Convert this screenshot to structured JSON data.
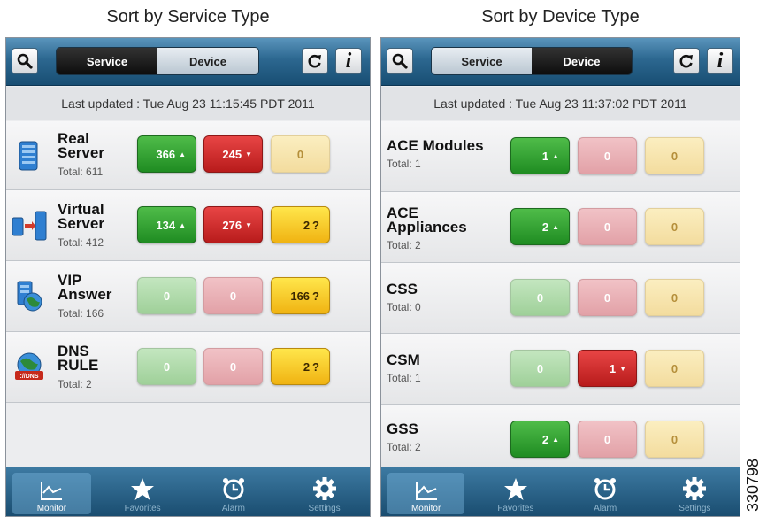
{
  "captions": {
    "left": "Sort by Service Type",
    "right": "Sort by Device Type"
  },
  "left_screen": {
    "segmented": {
      "service": "Service",
      "device": "Device",
      "selected": "Service"
    },
    "last_updated": "Last updated : Tue Aug 23 11:15:45 PDT 2011",
    "rows": [
      {
        "title": [
          "Real",
          "Server"
        ],
        "total": "Total: 611",
        "icon": "real-server-icon",
        "green": "366",
        "red": "245",
        "yellow": "0"
      },
      {
        "title": [
          "Virtual",
          "Server"
        ],
        "total": "Total: 412",
        "icon": "virtual-server-icon",
        "green": "134",
        "red": "276",
        "yellow": "2"
      },
      {
        "title": [
          "VIP",
          "Answer"
        ],
        "total": "Total: 166",
        "icon": "vip-answer-icon",
        "green": "0",
        "red": "0",
        "yellow": "166"
      },
      {
        "title": [
          "DNS",
          "RULE"
        ],
        "total": "Total: 2",
        "icon": "dns-rule-icon",
        "icon_text": "://DNS",
        "green": "0",
        "red": "0",
        "yellow": "2"
      }
    ]
  },
  "right_screen": {
    "segmented": {
      "service": "Service",
      "device": "Device",
      "selected": "Device"
    },
    "last_updated": "Last updated : Tue Aug 23 11:37:02 PDT 2011",
    "rows": [
      {
        "title": [
          "ACE Modules"
        ],
        "total": "Total: 1",
        "green": "1",
        "red": "0",
        "yellow": "0"
      },
      {
        "title": [
          "ACE",
          "Appliances"
        ],
        "total": "Total: 2",
        "green": "2",
        "red": "0",
        "yellow": "0"
      },
      {
        "title": [
          "CSS"
        ],
        "total": "Total: 0",
        "green": "0",
        "red": "0",
        "yellow": "0"
      },
      {
        "title": [
          "CSM"
        ],
        "total": "Total: 1",
        "green": "0",
        "red": "1",
        "yellow": "0"
      },
      {
        "title": [
          "GSS"
        ],
        "total": "Total: 2",
        "green": "2",
        "red": "0",
        "yellow": "0"
      }
    ]
  },
  "tabs": [
    {
      "label": "Monitor",
      "icon": "monitor-icon",
      "active": true
    },
    {
      "label": "Favorites",
      "icon": "star-icon",
      "active": false
    },
    {
      "label": "Alarm",
      "icon": "alarm-clock-icon",
      "active": false
    },
    {
      "label": "Settings",
      "icon": "gear-icon",
      "active": false
    }
  ],
  "symbols": {
    "up_arrow": "▲",
    "down_arrow": "▼",
    "question": "?"
  },
  "figure_id": "330798",
  "colors": {
    "green": "#2fa12f",
    "red": "#cf2a2a",
    "yellow": "#f3c31f",
    "header": "#2c6790"
  }
}
